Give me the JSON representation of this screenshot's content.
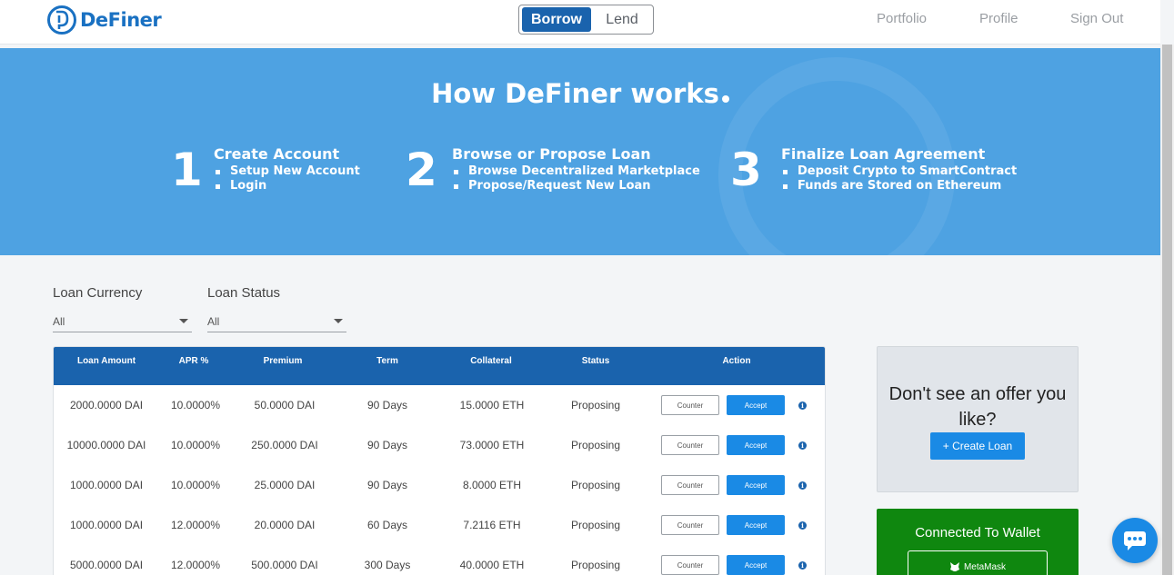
{
  "header": {
    "brand": "DeFiner",
    "toggle": {
      "borrow_label": "Borrow",
      "lend_label": "Lend",
      "active": "Borrow"
    },
    "nav": {
      "portfolio": "Portfolio",
      "profile": "Profile",
      "sign_out": "Sign Out"
    }
  },
  "hero": {
    "title": "How DeFiner works",
    "steps": [
      {
        "number": "1",
        "title": "Create Account",
        "items": [
          "Setup New Account",
          "Login"
        ]
      },
      {
        "number": "2",
        "title": "Browse or Propose Loan",
        "items": [
          "Browse Decentralized Marketplace",
          "Propose/Request New Loan"
        ]
      },
      {
        "number": "3",
        "title": "Finalize Loan Agreement",
        "items": [
          "Deposit Crypto to SmartContract",
          "Funds are Stored on Ethereum"
        ]
      }
    ]
  },
  "filters": {
    "currency": {
      "label": "Loan Currency",
      "value": "All"
    },
    "status": {
      "label": "Loan Status",
      "value": "All"
    }
  },
  "table": {
    "columns": [
      "Loan Amount",
      "APR %",
      "Premium",
      "Term",
      "Collateral",
      "Status",
      "Action"
    ],
    "counter_label": "Counter",
    "accept_label": "Accept",
    "rows": [
      {
        "amount": "2000.0000 DAI",
        "apr": "10.0000%",
        "premium": "50.0000 DAI",
        "term": "90 Days",
        "collateral": "15.0000 ETH",
        "status": "Proposing"
      },
      {
        "amount": "10000.0000 DAI",
        "apr": "10.0000%",
        "premium": "250.0000 DAI",
        "term": "90 Days",
        "collateral": "73.0000 ETH",
        "status": "Proposing"
      },
      {
        "amount": "1000.0000 DAI",
        "apr": "10.0000%",
        "premium": "25.0000 DAI",
        "term": "90 Days",
        "collateral": "8.0000 ETH",
        "status": "Proposing"
      },
      {
        "amount": "1000.0000 DAI",
        "apr": "12.0000%",
        "premium": "20.0000 DAI",
        "term": "60 Days",
        "collateral": "7.2116 ETH",
        "status": "Proposing"
      },
      {
        "amount": "5000.0000 DAI",
        "apr": "12.0000%",
        "premium": "500.0000 DAI",
        "term": "300 Days",
        "collateral": "40.0000 ETH",
        "status": "Proposing"
      }
    ]
  },
  "offer_card": {
    "text": "Don't see an offer you like?",
    "button": "+ Create Loan"
  },
  "wallet": {
    "title": "Connected To Wallet",
    "button": "MetaMask"
  },
  "colors": {
    "primary": "#1a63ad",
    "accent": "#1a8ae5",
    "hero": "#4ea2e2",
    "wallet": "#0f870f"
  }
}
